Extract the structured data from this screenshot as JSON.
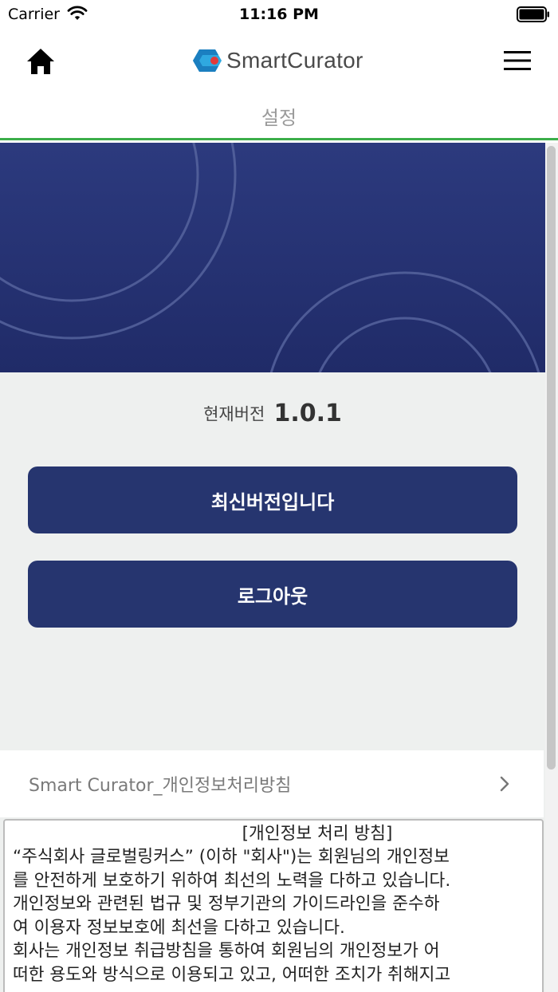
{
  "status_bar": {
    "carrier": "Carrier",
    "time": "11:16 PM"
  },
  "nav": {
    "logo_text": "SmartCurator",
    "page_title": "설정",
    "accent_color": "#3cae4a"
  },
  "settings": {
    "version_label": "현재버전",
    "version_value": "1.0.1",
    "latest_button": "최신버전입니다",
    "logout_button": "로그아웃"
  },
  "policy": {
    "row_label": "Smart Curator_개인정보처리방침",
    "heading": "[개인정보 처리 방침]",
    "lines": [
      "“주식회사 글로벌링커스” (이하 \"회사\")는 회원님의 개인정보",
      "를 안전하게 보호하기 위하여 최선의 노력을 다하고 있습니다.",
      "개인정보와 관련된 법규 및 정부기관의 가이드라인을 준수하",
      "여 이용자 정보보호에 최선을 다하고 있습니다.",
      "회사는 개인정보 취급방침을 통하여 회원님의 개인정보가 어",
      "떠한 용도와 방식으로 이용되고 있고, 어떠한 조치가 취해지고"
    ]
  },
  "colors": {
    "banner": "#26356f",
    "button": "#26356f",
    "background": "#eef0ef"
  },
  "icons": [
    "wifi-icon",
    "battery-icon",
    "home-icon",
    "logo-mark",
    "hamburger-menu-icon",
    "chevron-right-icon"
  ]
}
